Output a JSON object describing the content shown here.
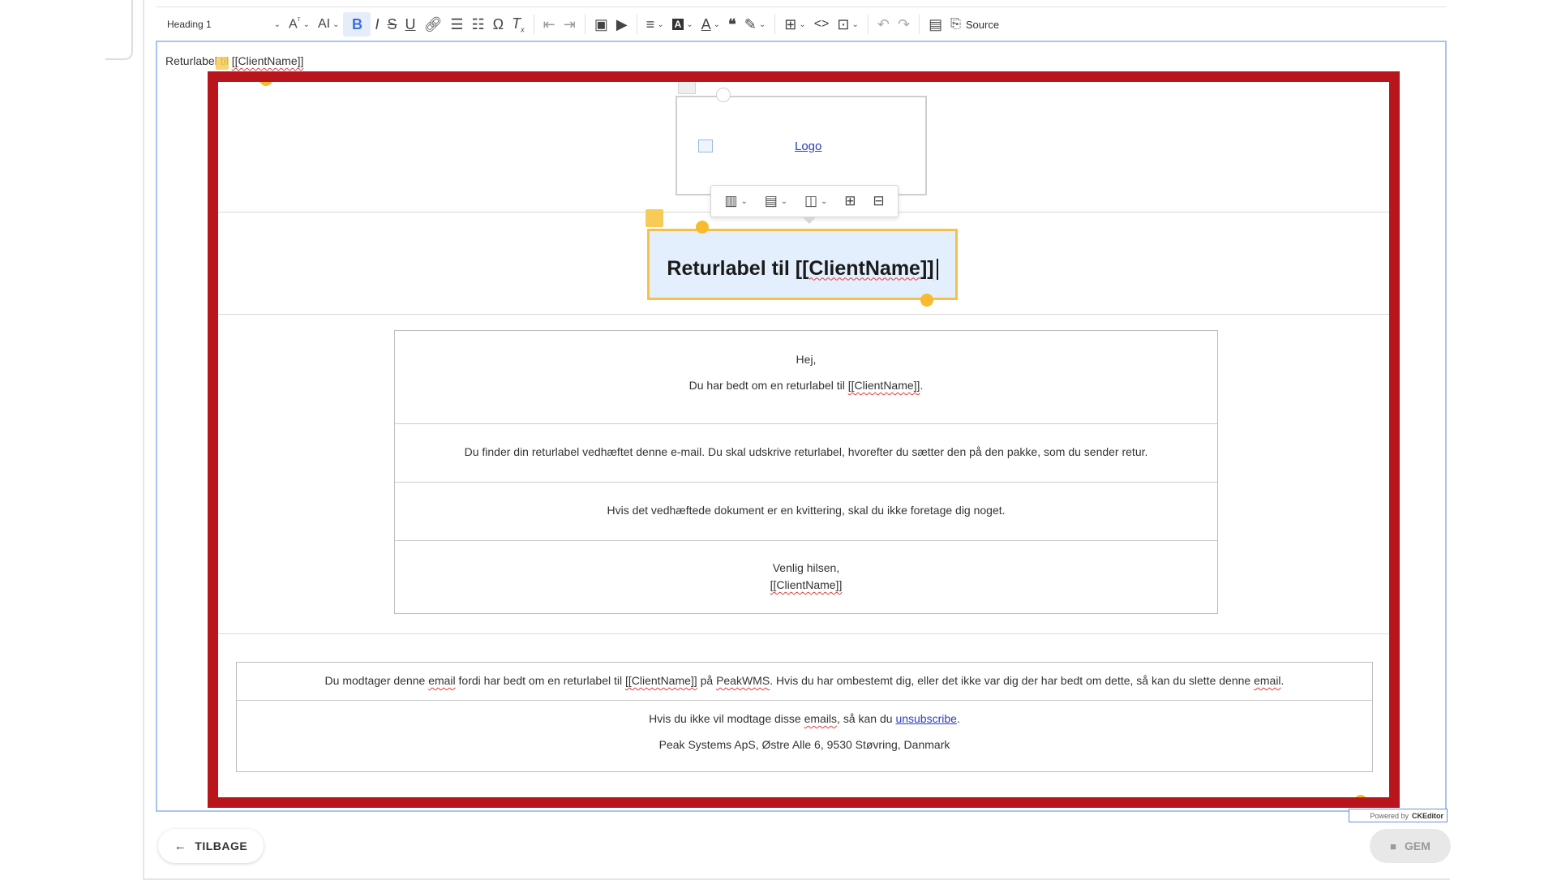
{
  "toolbar": {
    "heading_value": "Heading 1",
    "source_label": "Source",
    "icons": [
      "font-size-icon",
      "font-family-icon",
      "bold-icon",
      "italic-icon",
      "strikethrough-icon",
      "underline-icon",
      "link-icon",
      "bulleted-list-icon",
      "numbered-list-icon",
      "special-characters-icon",
      "remove-format-icon",
      "outdent-icon",
      "indent-icon",
      "insert-image-icon",
      "media-embed-icon",
      "alignment-icon",
      "font-background-color-icon",
      "font-color-icon",
      "blockquote-icon",
      "highlight-icon",
      "insert-table-icon",
      "code-icon",
      "html-embed-icon",
      "undo-icon",
      "redo-icon",
      "show-blocks-icon",
      "source-icon"
    ]
  },
  "editor": {
    "preview_prefix": "Returlabel til ",
    "preview_placeholder": "[[ClientName]]"
  },
  "template": {
    "logo_alt": "Logo",
    "heading_prefix": "Returlabel til ",
    "heading_placeholder": "[[ClientName]]",
    "body": {
      "greeting": "Hej,",
      "line1_prefix": "Du har bedt om en returlabel til ",
      "line1_placeholder": "[[ClientName]]",
      "line1_suffix": ".",
      "line2": "Du finder din returlabel vedhæftet denne e-mail. Du skal udskrive returlabel, hvorefter du sætter den på den pakke, som du sender retur.",
      "line3": "Hvis det vedhæftede dokument er en kvittering, skal du ikke foretage dig noget.",
      "signoff": "Venlig hilsen,",
      "signoff_name": "[[ClientName]]"
    },
    "footer": {
      "notice_a": "Du modtager denne ",
      "notice_email": "email",
      "notice_b": " fordi har bedt om en returlabel til ",
      "notice_client": "[[ClientName]]",
      "notice_c": " på ",
      "notice_peak": "PeakWMS",
      "notice_d": ". Hvis du har ombestemt dig, eller det ikke var dig der har bedt om dette, så kan du slette denne ",
      "notice_email2": "email",
      "notice_e": ".",
      "unsub_a": "Hvis du ikke vil modtage disse ",
      "unsub_emails": "emails",
      "unsub_b": ", så kan du ",
      "unsub_link": "unsubscribe",
      "unsub_c": ".",
      "address": "Peak Systems ApS, Østre Alle 6, 9530 Støvring, Danmark"
    }
  },
  "powered_by": {
    "prefix": "Powered by",
    "brand": "CKEditor"
  },
  "actions": {
    "back_label": "TILBAGE",
    "save_label": "GEM"
  },
  "colors": {
    "highlight_border": "#b9151c",
    "selection_yellow": "#f7bb2d",
    "heading_cell_bg": "#e4effd",
    "link": "#2a3ebf"
  }
}
